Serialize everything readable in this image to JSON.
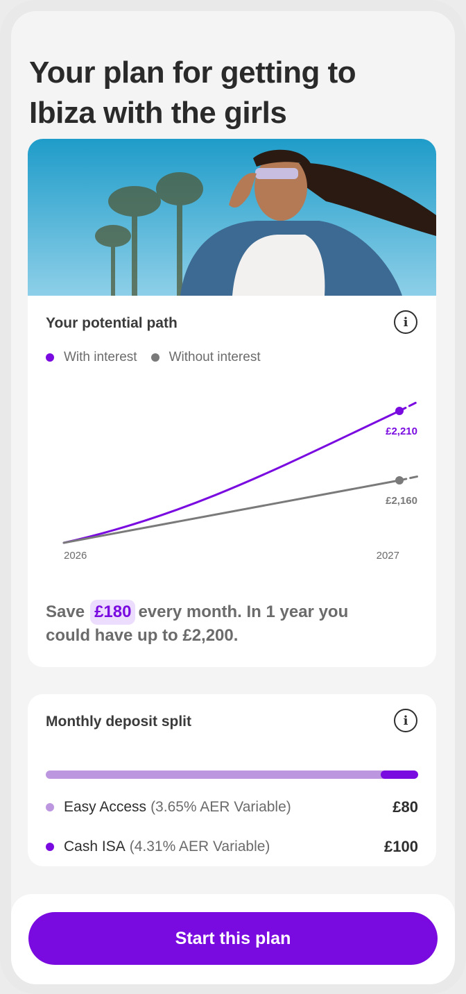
{
  "page": {
    "title": "Your plan for getting to Ibiza with the girls"
  },
  "path_card": {
    "heading": "Your potential path",
    "info_icon": "info-icon",
    "legend": [
      {
        "label": "With interest",
        "color": "#7a0be0"
      },
      {
        "label": "Without interest",
        "color": "#7a7a7a"
      }
    ],
    "summary": {
      "prefix": "Save",
      "amount": "£180",
      "suffix": "every month. In 1 year you could have up to £2,200."
    }
  },
  "chart_data": {
    "type": "line",
    "x_labels": [
      "2026",
      "2027"
    ],
    "series": [
      {
        "name": "With interest",
        "color": "#7a0be0",
        "end_label": "£2,210",
        "end_value": 2210
      },
      {
        "name": "Without interest",
        "color": "#7a7a7a",
        "end_label": "£2,160",
        "end_value": 2160
      }
    ]
  },
  "split_card": {
    "heading": "Monthly deposit split",
    "info_icon": "info-icon",
    "split_fraction_easy_access": 0.9,
    "rows": [
      {
        "name": "Easy Access",
        "rate": "(3.65% AER Variable)",
        "amount": "£80",
        "color": "#bd96e0"
      },
      {
        "name": "Cash ISA",
        "rate": "(4.31% AER Variable)",
        "amount": "£100",
        "color": "#7a0be0"
      }
    ]
  },
  "cta": {
    "label": "Start this plan"
  }
}
